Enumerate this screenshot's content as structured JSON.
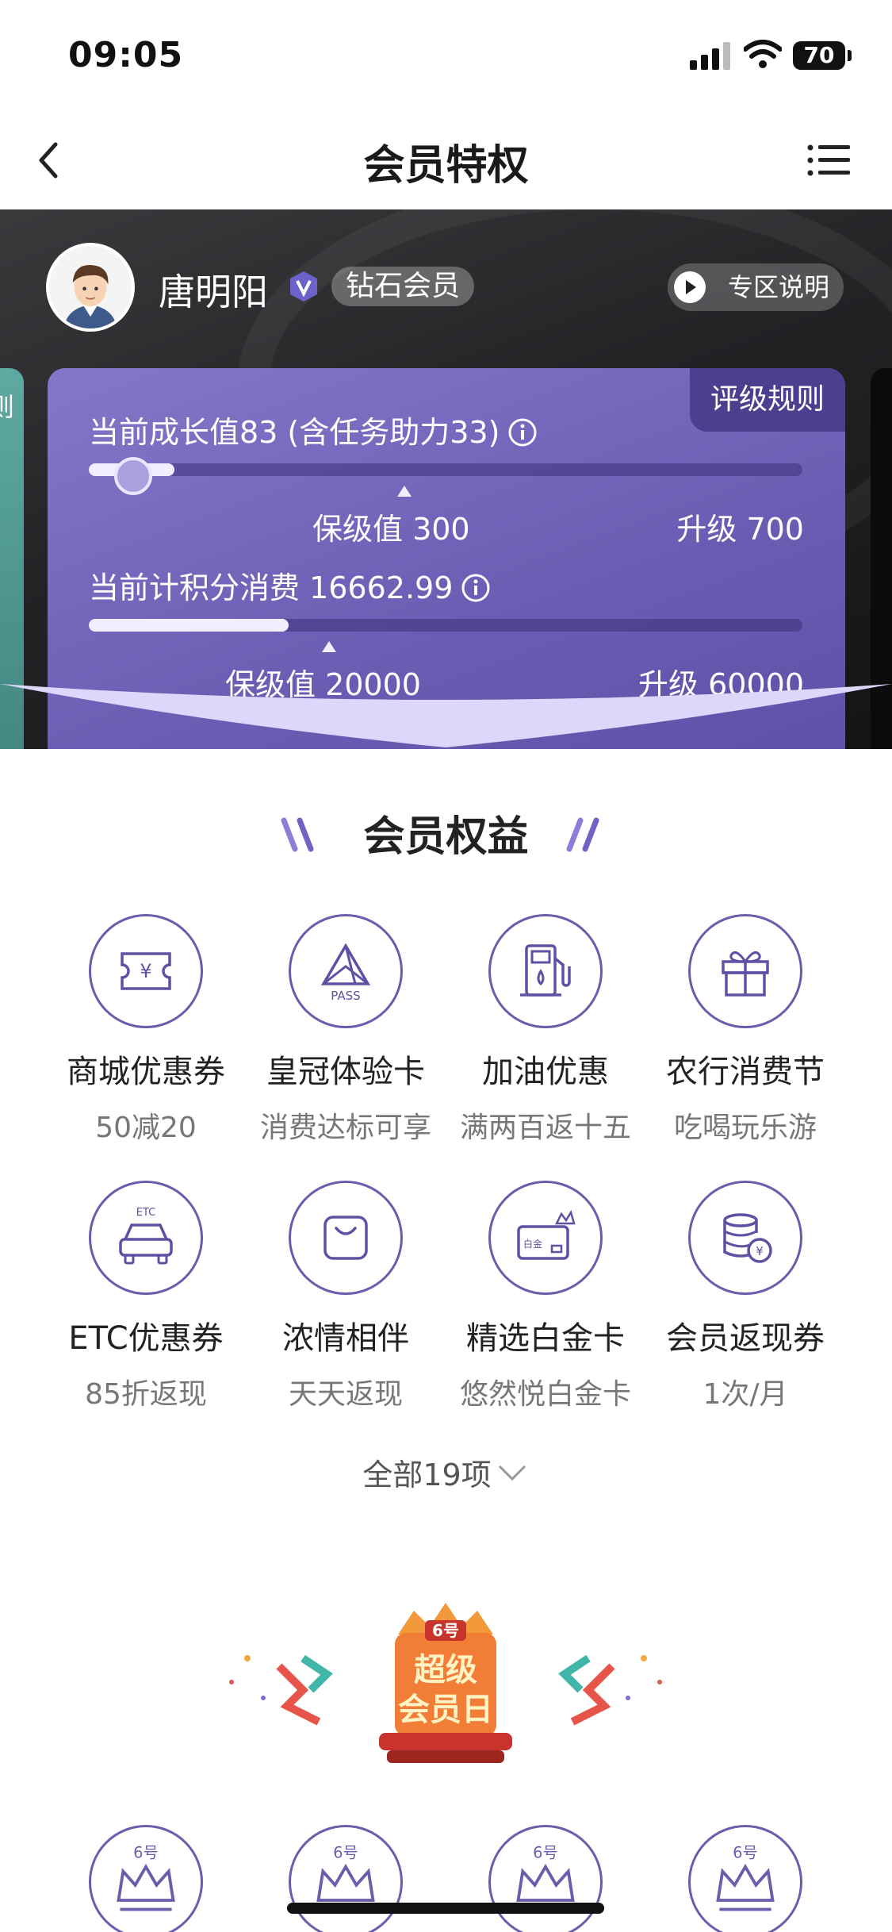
{
  "status_bar": {
    "time": "09:05",
    "battery": "70"
  },
  "nav": {
    "title": "会员特权"
  },
  "user": {
    "name": "唐明阳",
    "level": "钻石会员",
    "zone_label": "专区说明"
  },
  "level_card": {
    "rules_label": "评级规则",
    "growth_text": "当前成长值83 (含任务助力33)",
    "growth_progress_pct": 12,
    "growth_keep_label": "保级值 300",
    "growth_upgrade_label": "升级 700",
    "points_text": "当前计积分消费 16662.99",
    "points_progress_pct": 28,
    "points_keep_label": "保级值 20000",
    "points_upgrade_label": "升级 60000",
    "left_card_text": "则"
  },
  "benefits": {
    "title": "会员权益",
    "items": [
      {
        "name": "商城优惠券",
        "sub": "50减20",
        "icon": "coupon-icon"
      },
      {
        "name": "皇冠体验卡",
        "sub": "消费达标可享",
        "icon": "pass-icon",
        "icon_text": "PASS"
      },
      {
        "name": "加油优惠",
        "sub": "满两百返十五",
        "icon": "fuel-icon"
      },
      {
        "name": "农行消费节",
        "sub": "吃喝玩乐游",
        "icon": "gift-icon"
      },
      {
        "name": "ETC优惠券",
        "sub": "85折返现",
        "icon": "etc-car-icon",
        "icon_text": "ETC"
      },
      {
        "name": "浓情相伴",
        "sub": "天天返现",
        "icon": "bag-icon"
      },
      {
        "name": "精选白金卡",
        "sub": "悠然悦白金卡",
        "icon": "platinum-card-icon",
        "icon_text": "白金"
      },
      {
        "name": "会员返现券",
        "sub": "1次/月",
        "icon": "cashback-coins-icon"
      }
    ],
    "show_all": "全部19项"
  },
  "super_day": {
    "badge_number": "6号",
    "title_line1": "超级",
    "title_line2": "会员日",
    "crown_text": "6号"
  },
  "colors": {
    "accent": "#6a5dab",
    "card": "#6b5db3",
    "hero_dark": "#232326"
  }
}
